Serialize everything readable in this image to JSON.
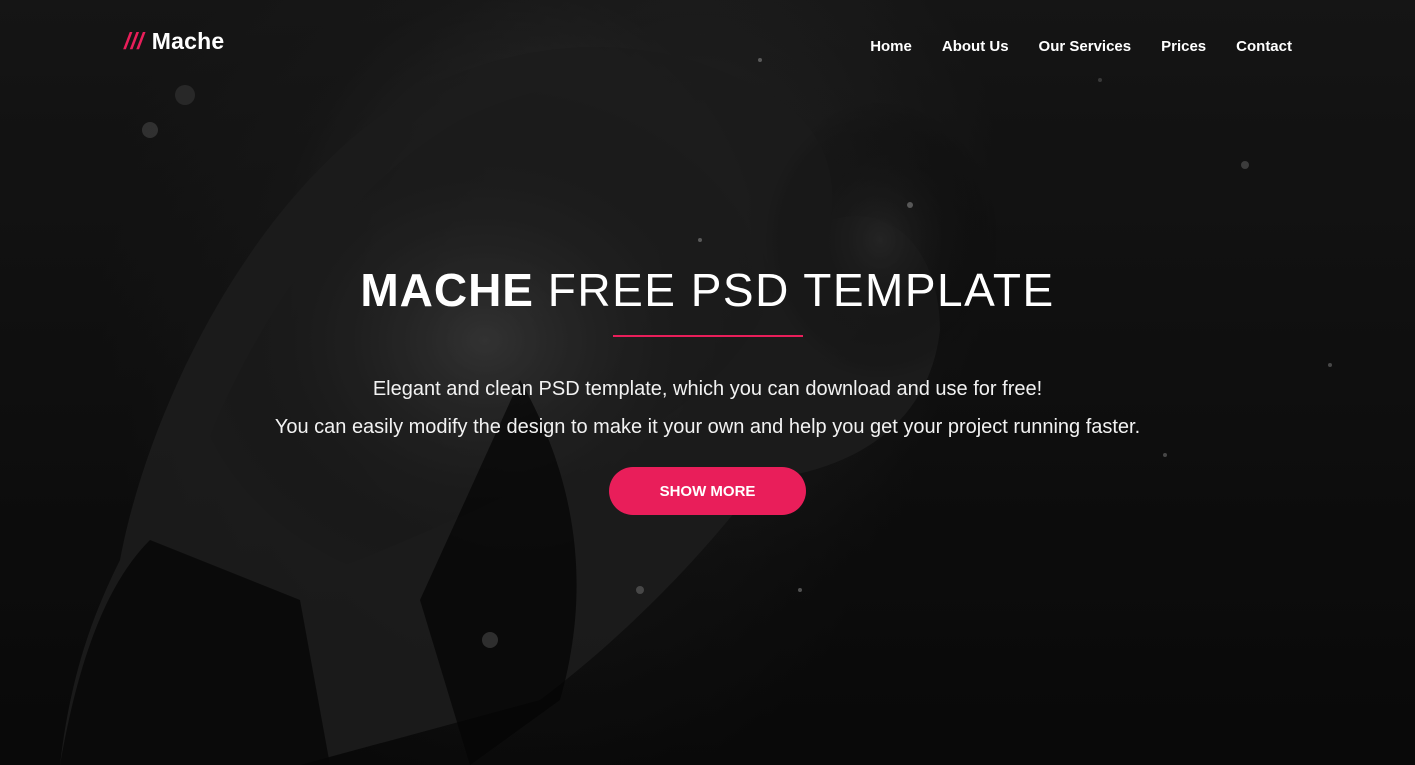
{
  "header": {
    "logo_slashes": "///",
    "logo_text": "Mache",
    "nav": [
      {
        "label": "Home"
      },
      {
        "label": "About Us"
      },
      {
        "label": "Our Services"
      },
      {
        "label": "Prices"
      },
      {
        "label": "Contact"
      }
    ]
  },
  "hero": {
    "title_bold": "MACHE",
    "title_light": "FREE PSD TEMPLATE",
    "description_line1": "Elegant and clean PSD template, which you can download and use for free!",
    "description_line2": "You can easily modify the design to make it your own and help you get your project running faster.",
    "button_label": "SHOW MORE"
  },
  "colors": {
    "accent": "#e91e5a",
    "text": "#ffffff",
    "background": "#141414"
  }
}
